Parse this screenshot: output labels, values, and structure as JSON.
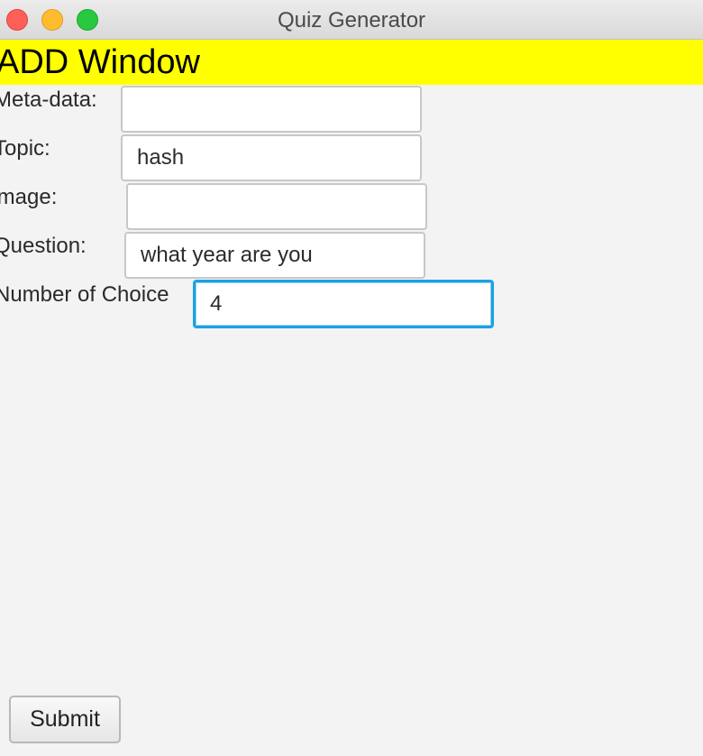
{
  "window": {
    "title": "Quiz Generator"
  },
  "header": {
    "text": "ADD Window",
    "background": "#ffff00"
  },
  "form": {
    "metadata": {
      "label": "Meta-data:",
      "value": ""
    },
    "topic": {
      "label": "Topic:",
      "value": "hash"
    },
    "image": {
      "label": "Image:",
      "value": ""
    },
    "question": {
      "label": "Question:",
      "value": "what year are you"
    },
    "choices": {
      "label": "Number of Choice",
      "value": "4"
    }
  },
  "actions": {
    "submit_label": "Submit"
  },
  "colors": {
    "focus_ring": "#1ba1e2",
    "close": "#fe5f57",
    "minimize": "#febc2e",
    "zoom": "#28c840"
  }
}
